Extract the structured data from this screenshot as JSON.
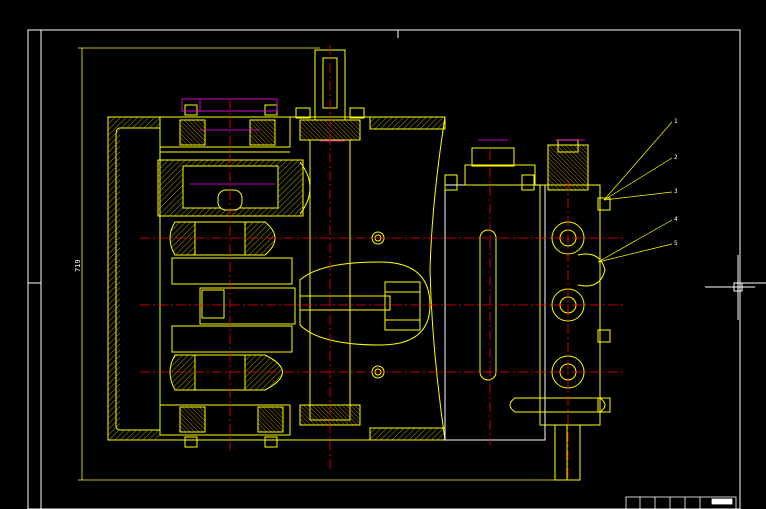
{
  "drawing": {
    "overall_dimension": "719",
    "balloon_labels": [
      "1",
      "2",
      "3",
      "4",
      "5"
    ],
    "colors": {
      "background": "#000000",
      "frame": "#ffffff",
      "body": "#ffff00",
      "hatch": "#c8c800",
      "centerline": "#ff0000",
      "dimension": "#ff00ff",
      "leader": "#ffff00",
      "annotation": "#ffffff"
    }
  }
}
